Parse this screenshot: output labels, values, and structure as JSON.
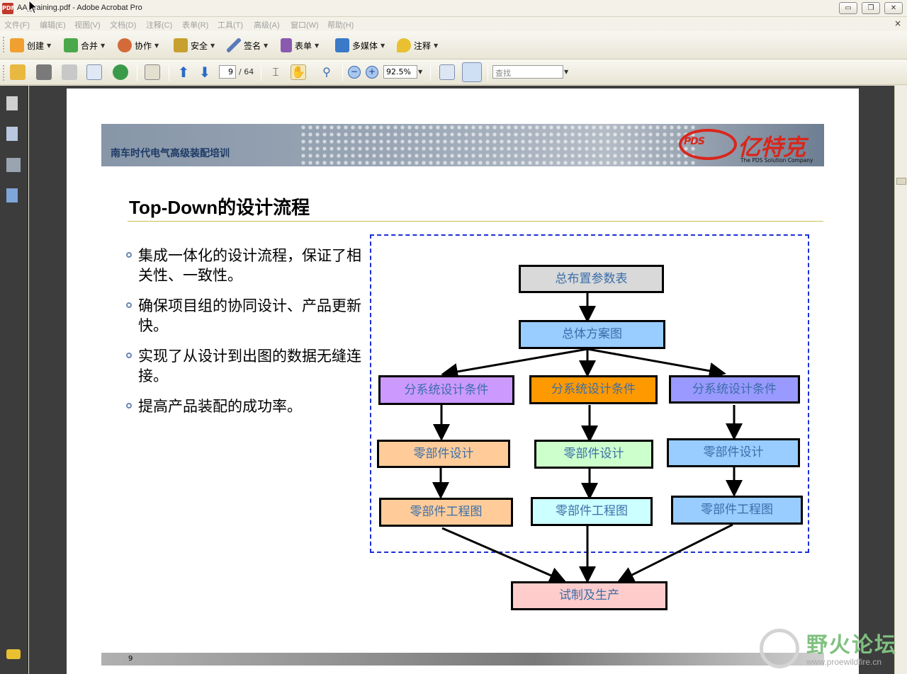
{
  "window": {
    "title": "AA_training.pdf - Adobe Acrobat Pro",
    "controls": [
      "▭",
      "❐",
      "✕"
    ]
  },
  "menubar": {
    "items": [
      "文件(F)",
      "编辑(E)",
      "视图(V)",
      "文档(D)",
      "注释(C)",
      "表单(R)",
      "工具(T)",
      "高级(A)",
      "窗口(W)",
      "帮助(H)"
    ],
    "close": "×"
  },
  "toolbar1": {
    "items": [
      {
        "label": "创建",
        "icon": "create-icon",
        "color": "#f0a030"
      },
      {
        "label": "合并",
        "icon": "combine-icon",
        "color": "#4aa84a"
      },
      {
        "label": "协作",
        "icon": "collaborate-icon",
        "color": "#d46a3a"
      },
      {
        "label": "安全",
        "icon": "lock-icon",
        "color": "#c8a030"
      },
      {
        "label": "签名",
        "icon": "pen-icon",
        "color": "#5a7ab8"
      },
      {
        "label": "表单",
        "icon": "form-icon",
        "color": "#8a5ab0"
      },
      {
        "label": "多媒体",
        "icon": "multimedia-icon",
        "color": "#3a7ac8"
      },
      {
        "label": "注释",
        "icon": "comment-icon",
        "color": "#e8c030"
      }
    ]
  },
  "toolbar2": {
    "page_current": "9",
    "page_total": "/ 64",
    "zoom": "92.5%",
    "search_placeholder": "查找"
  },
  "page": {
    "banner_text": "南车时代电气高级装配培训",
    "logo_mark": "PDS",
    "logo_text": "亿特克",
    "logo_sub": "The PDS Solution Company",
    "title": "Top-Down的设计流程",
    "bullets": [
      "集成一体化的设计流程，保证了相关性、一致性。",
      "确保项目组的协同设计、产品更新快。",
      "实现了从设计到出图的数据无缝连接。",
      "提高产品装配的成功率。"
    ],
    "flow": {
      "top": "总布置参数表",
      "scheme": "总体方案图",
      "sub_a": "分系统设计条件",
      "sub_b": "分系统设计条件",
      "sub_c": "分系统设计条件",
      "part_a": "零部件设计",
      "part_b": "零部件设计",
      "part_c": "零部件设计",
      "drawing_a": "零部件工程图",
      "drawing_b": "零部件工程图",
      "drawing_c": "零部件工程图",
      "production": "试制及生产"
    },
    "footer_page_number": "9"
  },
  "watermark": {
    "main": "野火论坛",
    "sub": "www.proewildfire.cn"
  },
  "colors": {
    "box_top": "#d9d9d9",
    "box_scheme": "#99ccff",
    "box_sub_a": "#cc99ff",
    "box_sub_b": "#ff9900",
    "box_sub_c": "#9999ff",
    "box_part_a": "#ffcc99",
    "box_part_b": "#ccffcc",
    "box_part_c": "#99ccff",
    "box_drawing_a": "#ffcc99",
    "box_drawing_b": "#ccffff",
    "box_drawing_c": "#99ccff",
    "box_production": "#ffcccc"
  }
}
